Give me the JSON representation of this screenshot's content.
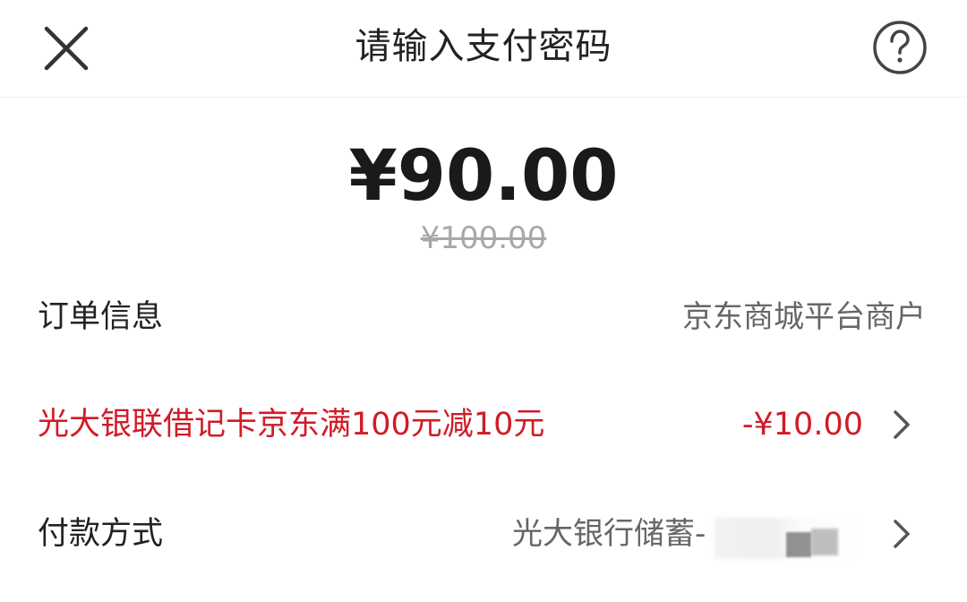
{
  "header": {
    "title": "请输入支付密码",
    "close_icon": "close-icon",
    "help_icon": "question-circle-icon"
  },
  "payment": {
    "amount": "¥90.00",
    "original_amount": "¥100.00"
  },
  "order": {
    "label": "订单信息",
    "merchant": "京东商城平台商户"
  },
  "promotion": {
    "label": "光大银联借记卡京东满100元减10元",
    "discount": "-¥10.00",
    "accent_color": "#d01c28"
  },
  "payment_method": {
    "label": "付款方式",
    "value": "光大银行储蓄-"
  }
}
